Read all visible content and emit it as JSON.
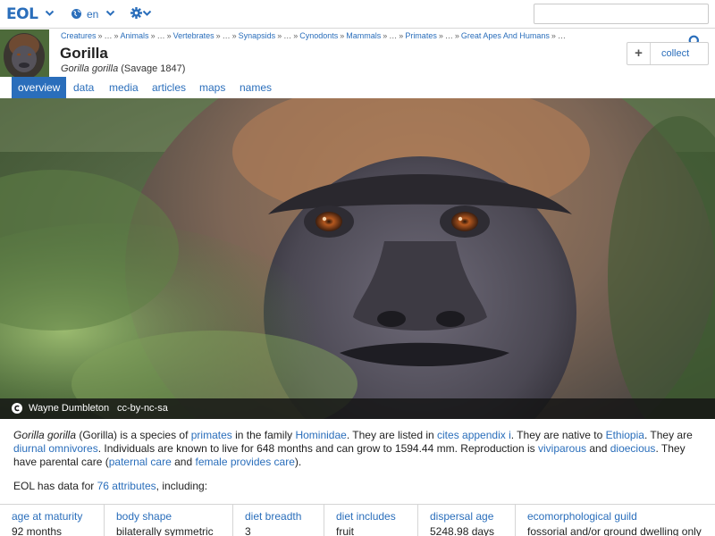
{
  "topbar": {
    "logo": "EOL",
    "language": "en",
    "search_placeholder": ""
  },
  "header": {
    "breadcrumb": [
      {
        "label": "Creatures",
        "link": true
      },
      {
        "label": "…",
        "link": false
      },
      {
        "label": "Animals",
        "link": true
      },
      {
        "label": "…",
        "link": false
      },
      {
        "label": "Vertebrates",
        "link": true
      },
      {
        "label": "…",
        "link": false
      },
      {
        "label": "Synapsids",
        "link": true
      },
      {
        "label": "…",
        "link": false
      },
      {
        "label": "Cynodonts",
        "link": true
      },
      {
        "label": "Mammals",
        "link": true
      },
      {
        "label": "…",
        "link": false
      },
      {
        "label": "Primates",
        "link": true
      },
      {
        "label": "…",
        "link": false
      },
      {
        "label": "Great Apes And Humans",
        "link": true
      },
      {
        "label": "…",
        "link": false
      }
    ],
    "title": "Gorilla",
    "scientific_name": "Gorilla gorilla",
    "authority": "(Savage 1847)",
    "collect_label": "collect"
  },
  "tabs": [
    "overview",
    "data",
    "media",
    "articles",
    "maps",
    "names"
  ],
  "active_tab": "overview",
  "hero": {
    "author": "Wayne Dumbleton",
    "license": "cc-by-nc-sa"
  },
  "description": {
    "p1_a": "Gorilla gorilla",
    "p1_b": " (Gorilla) is a species of ",
    "l_primates": "primates",
    "p1_c": " in the family ",
    "l_hominidae": "Hominidae",
    "p1_d": ". They are listed in ",
    "l_cites": "cites appendix i",
    "p1_e": ". They are native to ",
    "l_ethiopia": "Ethiopia",
    "p1_f": ". They are ",
    "l_diurnal": "diurnal omnivores",
    "p1_g": ". Individuals are known to live for 648 months and can grow to 1594.44 mm. Reproduction is ",
    "l_viviparous": "viviparous",
    "p1_h": " and ",
    "l_dioecious": "dioecious",
    "p1_i": ". They have parental care (",
    "l_paternal": "paternal care",
    "p1_j": " and ",
    "l_female": "female provides care",
    "p1_k": ")."
  },
  "data_note": {
    "before": "EOL has data for ",
    "link": "76 attributes",
    "after": ", including:"
  },
  "attributes": [
    {
      "label": "age at maturity",
      "value": "92 months"
    },
    {
      "label": "body shape",
      "value": "bilaterally symmetric"
    },
    {
      "label": "diet breadth",
      "value": "3"
    },
    {
      "label": "diet includes",
      "value": "fruit"
    },
    {
      "label": "dispersal age",
      "value": "5248.98 days"
    },
    {
      "label": "ecomorphological guild",
      "value": "fossorial and/or ground dwelling only"
    }
  ],
  "colors": {
    "accent": "#2a6ebb",
    "caption_bar": "#141414"
  },
  "icons": [
    "eol-logo",
    "chevron-down-icon",
    "globe-icon",
    "gear-icon",
    "search-icon",
    "plus-icon",
    "copyright-icon"
  ]
}
